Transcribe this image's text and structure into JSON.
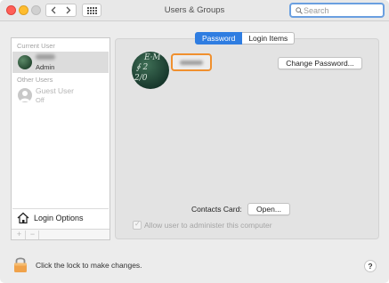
{
  "window": {
    "title": "Users & Groups"
  },
  "search": {
    "placeholder": "Search",
    "value": ""
  },
  "sidebar": {
    "current_user_label": "Current User",
    "current_user": {
      "role": "Admin"
    },
    "other_users_label": "Other Users",
    "guest_user": {
      "name": "Guest User",
      "status": "Off"
    },
    "login_options_label": "Login Options",
    "add_label": "+",
    "remove_label": "−"
  },
  "tabs": [
    {
      "label": "Password",
      "active": true
    },
    {
      "label": "Login Items",
      "active": false
    }
  ],
  "main": {
    "change_password_label": "Change Password...",
    "contacts_card_label": "Contacts Card:",
    "open_label": "Open...",
    "allow_admin_label": "Allow user to administer this computer",
    "allow_admin_checked": true
  },
  "footer": {
    "lock_text": "Click the lock to make changes.",
    "help_label": "?"
  },
  "colors": {
    "accent": "#2f7de1",
    "focus_ring": "#f0902e",
    "lock": "#f0a24a"
  }
}
